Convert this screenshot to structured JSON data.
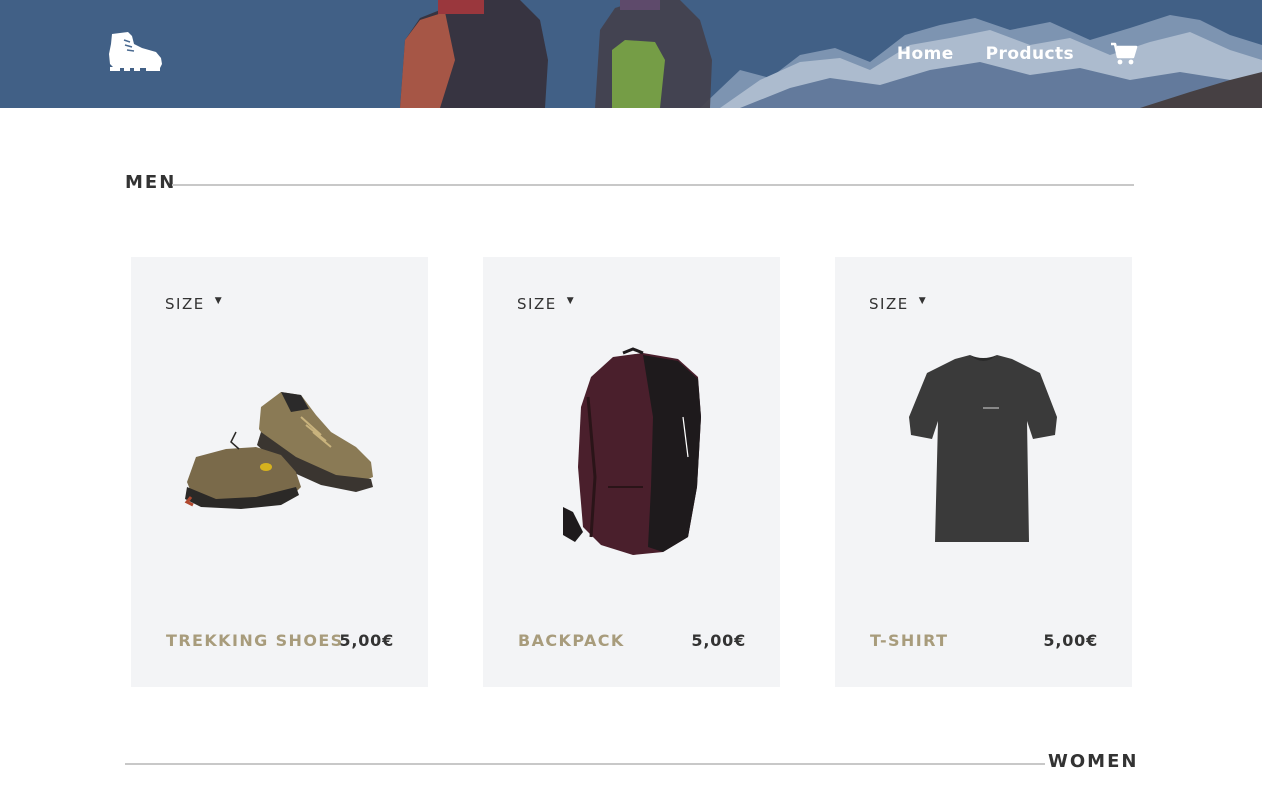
{
  "header": {
    "logo_icon": "hiking-boot-icon",
    "nav": {
      "home": "Home",
      "products": "Products"
    },
    "cart_icon": "shopping-cart-icon"
  },
  "sections": {
    "men": {
      "title": "MEN"
    },
    "women": {
      "title": "WOMEN"
    }
  },
  "products": [
    {
      "size_label": "SIZE",
      "name": "TREKKING SHOES",
      "price": "5,00€",
      "image": "trekking-shoes"
    },
    {
      "size_label": "SIZE",
      "name": "BACKPACK",
      "price": "5,00€",
      "image": "backpack"
    },
    {
      "size_label": "SIZE",
      "name": "T-SHIRT",
      "price": "5,00€",
      "image": "t-shirt"
    }
  ],
  "colors": {
    "header_bg": "#4a6a91",
    "card_bg": "#f3f4f6",
    "product_name": "#a89c7c",
    "text": "#333333"
  }
}
